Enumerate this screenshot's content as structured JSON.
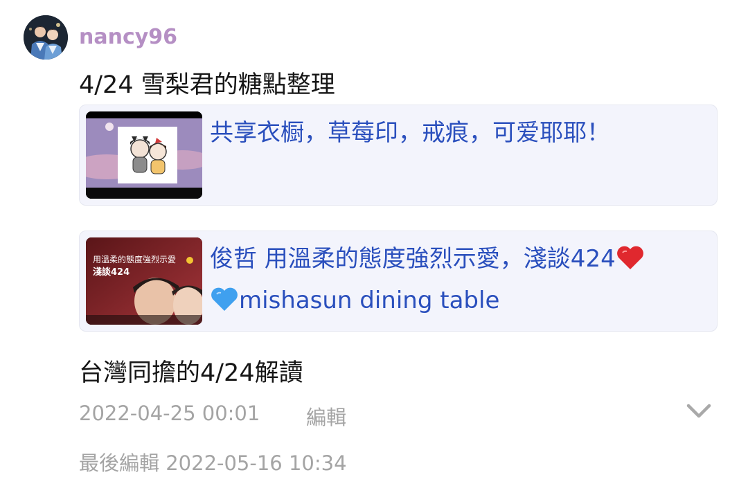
{
  "post": {
    "author": "nancy96",
    "title": "4/24 雪梨君的糖點整理",
    "link_cards": [
      {
        "title": "共享衣橱，草莓印，戒痕，可爱耶耶！",
        "thumbnail": "cartoon-couple-thumbnail"
      },
      {
        "title_line1": "俊哲 用溫柔的態度強烈示愛，淺談424",
        "title_line2": "mishasun dining table",
        "heart_red_icon": "red-heart-emoji",
        "heart_blue_icon": "blue-heart-emoji",
        "thumbnail_caption_line1": "用溫柔的態度強烈示愛",
        "thumbnail_caption_line2": "淺談424",
        "thumbnail": "video-thumbnail"
      }
    ],
    "body": "台灣同擔的4/24解讀",
    "timestamp": "2022-04-25 00:01",
    "edit_label": "編輯",
    "last_edited": "最後編輯 2022-05-16 10:34",
    "expand_icon": "chevron-down-icon"
  },
  "colors": {
    "username": "#b58fc4",
    "link": "#2a4fbd",
    "card_bg": "#f3f4fc",
    "meta": "#a4a4a4"
  }
}
